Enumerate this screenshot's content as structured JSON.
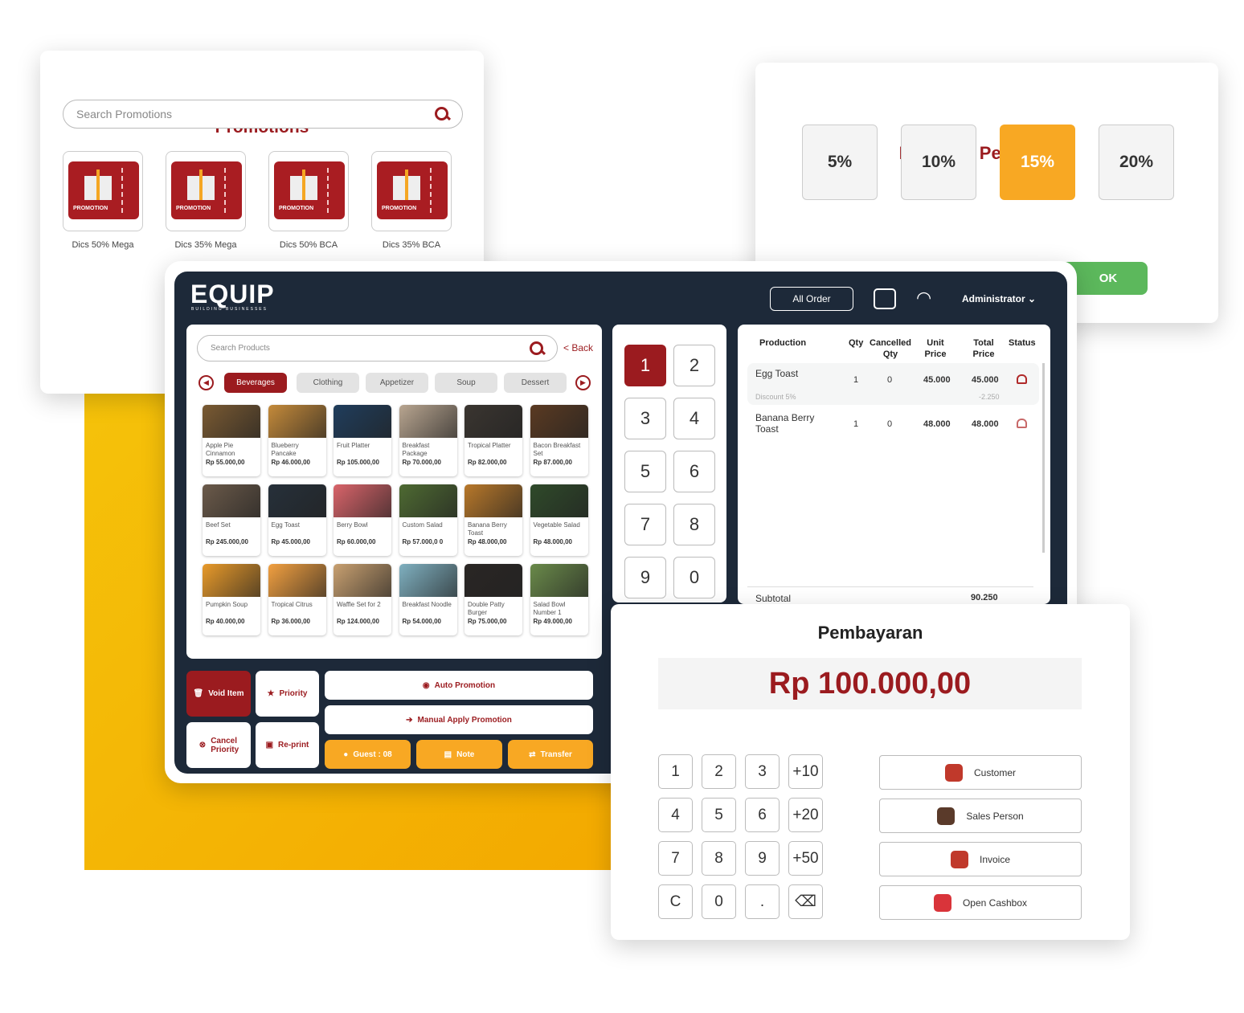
{
  "colors": {
    "brand": "#9b1b1f",
    "accent": "#f8a823",
    "ok": "#5cb85c",
    "dark": "#1d2939"
  },
  "promotions": {
    "title": "Promotions",
    "search_placeholder": "Search Promotions",
    "badge_text": "PROMOTION",
    "items": [
      {
        "label": "Dics 50% Mega"
      },
      {
        "label": "Dics 35% Mega"
      },
      {
        "label": "Dics 50% BCA"
      },
      {
        "label": "Dics 35% BCA"
      }
    ]
  },
  "discount": {
    "title": "Discount Percentage",
    "options": [
      "5%",
      "10%",
      "15%",
      "20%"
    ],
    "selected": "15%",
    "ok_label": "OK"
  },
  "header": {
    "logo": "EQUIP",
    "logo_tagline": "BUILDING BUSINESSES",
    "all_order": "All Order",
    "user": "Administrator",
    "icons": [
      "printer-icon",
      "wifi-icon",
      "chevron-down-icon"
    ]
  },
  "products": {
    "search_placeholder": "Search Products",
    "back": "< Back",
    "categories": [
      "Beverages",
      "Clothing",
      "Appetizer",
      "Soup",
      "Dessert"
    ],
    "selected_category": "Beverages",
    "items": [
      {
        "name": "Apple Pie Cinnamon",
        "price": "Rp 55.000,00",
        "color": "#7a5a32"
      },
      {
        "name": "Blueberry Pancake",
        "price": "Rp 46.000,00",
        "color": "#c48a3a"
      },
      {
        "name": "Fruit Platter",
        "price": "Rp 105.000,00",
        "color": "#1f3d5c"
      },
      {
        "name": "Breakfast Package",
        "price": "Rp 70.000,00",
        "color": "#b8a590"
      },
      {
        "name": "Tropical Platter",
        "price": "Rp 82.000,00",
        "color": "#3a3530"
      },
      {
        "name": "Bacon Breakfast Set",
        "price": "Rp 87.000,00",
        "color": "#5a3a22"
      },
      {
        "name": "Beef Set",
        "price": "Rp 245.000,00",
        "color": "#6b5a4a"
      },
      {
        "name": "Egg Toast",
        "price": "Rp 45.000,00",
        "color": "#26303a"
      },
      {
        "name": "Berry Bowl",
        "price": "Rp 60.000,00",
        "color": "#d9646a"
      },
      {
        "name": "Custom Salad",
        "price": "Rp 57.000,0 0",
        "color": "#4e6a32"
      },
      {
        "name": "Banana Berry Toast",
        "price": "Rp 48.000,00",
        "color": "#b8782a"
      },
      {
        "name": "Vegetable Salad",
        "price": "Rp 48.000,00",
        "color": "#2f4a2a"
      },
      {
        "name": "Pumpkin Soup",
        "price": "Rp 40.000,00",
        "color": "#e89a2a"
      },
      {
        "name": "Tropical Citrus",
        "price": "Rp 36.000,00",
        "color": "#f2a040"
      },
      {
        "name": "Waffle Set for 2",
        "price": "Rp 124.000,00",
        "color": "#c8a070"
      },
      {
        "name": "Breakfast Noodle",
        "price": "Rp 54.000,00",
        "color": "#7fb0c0"
      },
      {
        "name": "Double Patty Burger",
        "price": "Rp 75.000,00",
        "color": "#2a2624"
      },
      {
        "name": "Salad Bowl Number 1",
        "price": "Rp 49.000,00",
        "color": "#6a8a4a"
      }
    ]
  },
  "numpad": {
    "keys": [
      "1",
      "2",
      "3",
      "4",
      "5",
      "6",
      "7",
      "8",
      "9",
      "0"
    ],
    "selected": "1"
  },
  "order": {
    "columns": [
      "Production",
      "Qty",
      "Cancelled Qty",
      "Unit Price",
      "Total Price",
      "Status"
    ],
    "rows": [
      {
        "name": "Egg Toast",
        "qty": "1",
        "cancelled": "0",
        "unit": "45.000",
        "total": "45.000",
        "discount_label": "Discount 5%",
        "discount_value": "-2.250"
      },
      {
        "name": "Banana Berry Toast",
        "qty": "1",
        "cancelled": "0",
        "unit": "48.000",
        "total": "48.000"
      }
    ],
    "subtotal_label": "Subtotal",
    "subtotal": "90.250"
  },
  "actions": {
    "void_item": "Void Item",
    "priority": "Priority",
    "cancel_priority": "Cancel Priority",
    "reprint": "Re-print",
    "auto_promotion": "Auto Promotion",
    "manual_promotion": "Manual Apply Promotion",
    "guest": "Guest : 08",
    "note": "Note",
    "transfer": "Transfer"
  },
  "payment": {
    "title": "Pembayaran",
    "amount": "Rp 100.000,00",
    "keys": [
      "1",
      "2",
      "3",
      "+10",
      "4",
      "5",
      "6",
      "+20",
      "7",
      "8",
      "9",
      "+50",
      "C",
      "0",
      "."
    ],
    "buttons": [
      {
        "label": "Customer",
        "color": "#c0392b"
      },
      {
        "label": "Sales Person",
        "color": "#5a3a2a"
      },
      {
        "label": "Invoice",
        "color": "#c0392b"
      },
      {
        "label": "Open Cashbox",
        "color": "#d9343a"
      }
    ]
  }
}
